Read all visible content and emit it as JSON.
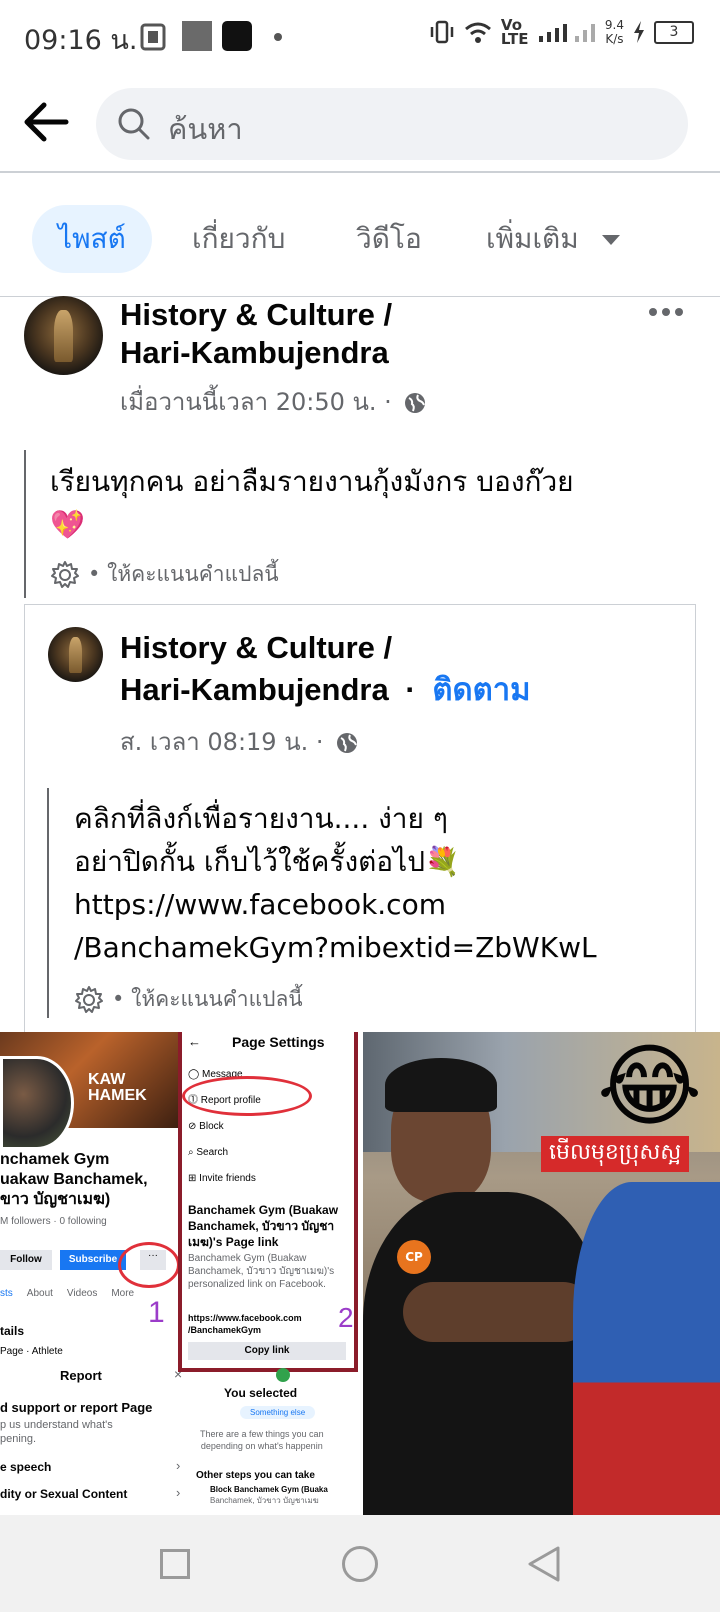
{
  "status_bar": {
    "time": "09:16 น.",
    "network": "Vo LTE",
    "speed": "9.4",
    "speed_unit": "K/s",
    "battery": "3"
  },
  "header": {
    "search_placeholder": "ค้นหา"
  },
  "tabs": [
    {
      "label": "ไพสต์",
      "active": true
    },
    {
      "label": "เกี่ยวกับ",
      "active": false
    },
    {
      "label": "วิดีโอ",
      "active": false
    },
    {
      "label": "เพิ่มเติม",
      "active": false
    }
  ],
  "post": {
    "page_name_line1": "History & Culture /",
    "page_name_line2": "Hari-Kambujendra",
    "timestamp": "เมื่อวานนี้เวลา 20:50 น. ·",
    "text_line1": "เรียนทุกคน อย่าลืมรายงานกุ้งมังกร บองก๊วย",
    "text_emoji": "💖",
    "rate_translation": "ให้คะแนนคำแปลนี้"
  },
  "shared_post": {
    "page_name_line1": "History & Culture /",
    "page_name_line2": "Hari-Kambujendra",
    "dot": "·",
    "follow_label": "ติดตาม",
    "timestamp": "ส. เวลา 08:19 น. ·",
    "text_line1": "คลิกที่ลิงก์เพื่อรายงาน.... ง่าย ๆ",
    "text_line2": "อย่าปิดกั้น เก็บไว้ใช้ครั้งต่อไป💐",
    "text_line3": "https://www.facebook.com",
    "text_line4": "/BanchamekGym?mibextid=ZbWKwL",
    "rate_translation": "ให้คะแนนคำแปลนี้"
  },
  "image_left": {
    "cover_text": "KAW HAMEK",
    "profile_name_1": "nchamek Gym",
    "profile_name_2": "uakaw Banchamek,",
    "profile_name_3": "ขาว บัญชาเมฆ)",
    "followers": "M followers · 0 following",
    "follow_btn": "Follow",
    "subscribe_btn": "Subscribe",
    "tabs": [
      "sts",
      "About",
      "Videos",
      "More"
    ],
    "step1": "1",
    "details": "tails",
    "page_athlete": "Page · Athlete",
    "report_title": "Report",
    "report_heading": "d support or report Page",
    "report_sub1": "p us understand what's",
    "report_sub2": "pening.",
    "report_item1": "e speech",
    "report_item2": "dity or Sexual Content",
    "settings_title": "Page Settings",
    "menu": [
      "Message",
      "Report profile",
      "Block",
      "Search",
      "Invite friends"
    ],
    "link_title1": "Banchamek Gym (Buakaw",
    "link_title2": "Banchamek, บัวขาว บัญชา",
    "link_title3": "เมฆ)'s Page link",
    "link_desc1": "Banchamek Gym (Buakaw",
    "link_desc2": "Banchamek, บัวขาว บัญชาเมฆ)'s",
    "link_desc3": "personalized link on Facebook.",
    "link_url1": "https://www.facebook.com",
    "link_url2": "/BanchamekGym",
    "copy_link": "Copy link",
    "step2": "2",
    "you_selected": "You selected",
    "something_else": "Something else",
    "few_things1": "There are a few things you can",
    "few_things2": "depending on what's happenin",
    "other_steps": "Other steps you can take",
    "block_item1": "Block Banchamek Gym (Buaka",
    "block_item2": "Banchamek, บัวขาว บัญชาเมฆ"
  },
  "image_right": {
    "emoji": "😂",
    "khmer_text": "មើលមុខប្រុសស្អ",
    "patch_text": "CP"
  },
  "colors": {
    "accent": "#1877f2",
    "text_secondary": "#65676b",
    "tab_active_bg": "#e7f3ff",
    "search_bg": "#f0f2f5"
  }
}
